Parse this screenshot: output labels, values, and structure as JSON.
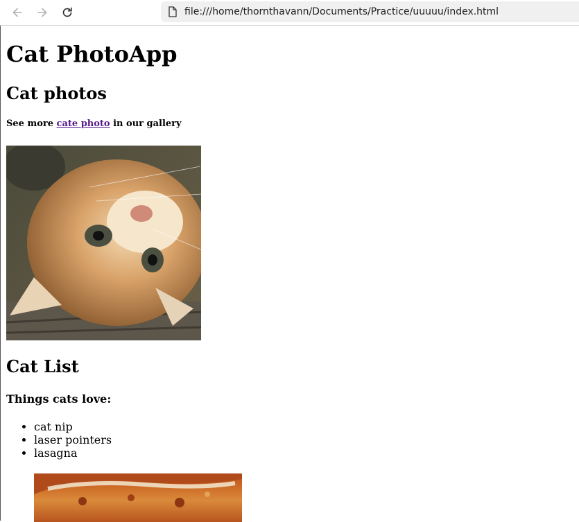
{
  "browser": {
    "url": "file:///home/thornthavann/Documents/Practice/uuuuu/index.html",
    "back_icon": "arrow-left-icon",
    "forward_icon": "arrow-right-icon",
    "reload_icon": "reload-icon",
    "page_icon": "file-icon"
  },
  "page": {
    "title": "Cat PhotoApp",
    "photos_heading": "Cat photos",
    "more_prefix": "See more",
    "more_link": "cate photo",
    "more_suffix": "in our gallery",
    "list_heading": "Cat List",
    "love_heading": "Things cats love:",
    "items": [
      "cat nip",
      "laser pointers",
      "lasagna"
    ],
    "link_color": "#551a8b"
  }
}
